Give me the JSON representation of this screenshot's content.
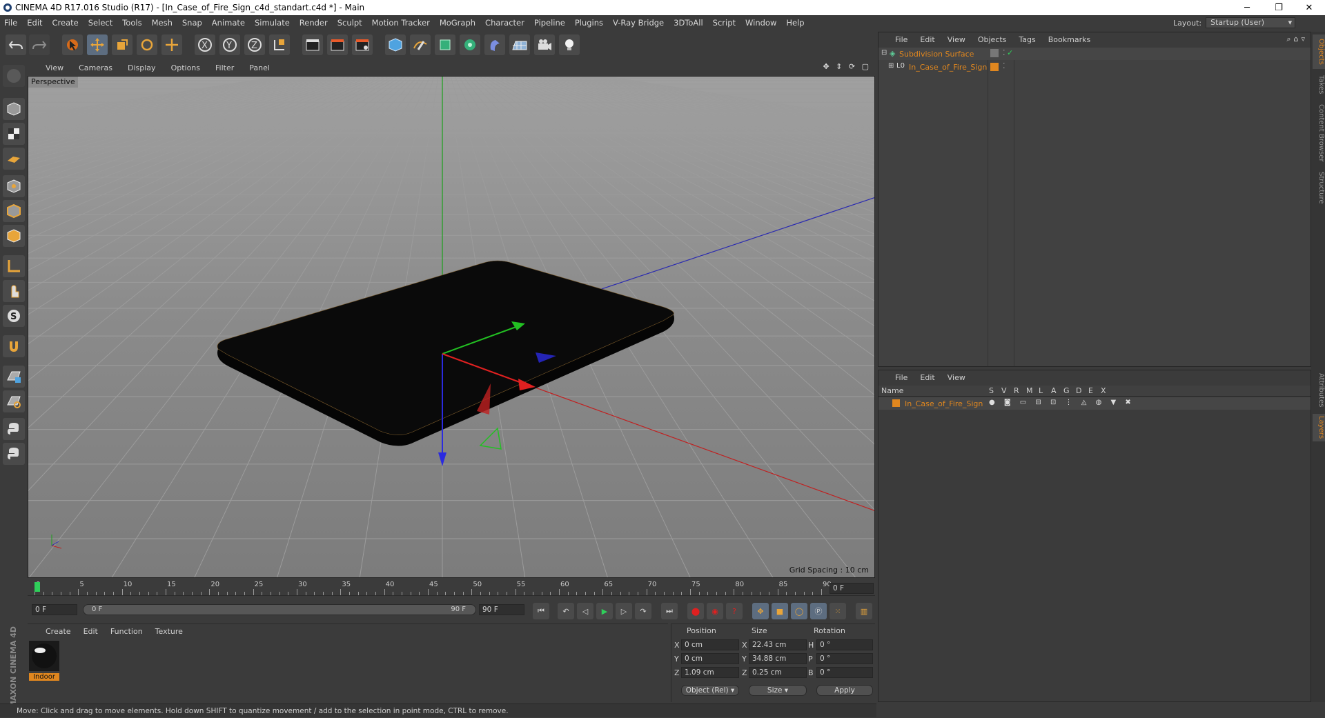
{
  "window": {
    "title": "CINEMA 4D R17.016 Studio (R17) - [In_Case_of_Fire_Sign_c4d_standart.c4d *] - Main",
    "minimize": "─",
    "restore": "❐",
    "close": "✕"
  },
  "menu": [
    "File",
    "Edit",
    "Create",
    "Select",
    "Tools",
    "Mesh",
    "Snap",
    "Animate",
    "Simulate",
    "Render",
    "Sculpt",
    "Motion Tracker",
    "MoGraph",
    "Character",
    "Pipeline",
    "Plugins",
    "V-Ray Bridge",
    "3DToAll",
    "Script",
    "Window",
    "Help"
  ],
  "layout": {
    "label": "Layout:",
    "value": "Startup (User)"
  },
  "viewport": {
    "menu": [
      "View",
      "Cameras",
      "Display",
      "Options",
      "Filter",
      "Panel"
    ],
    "name": "Perspective",
    "grid_spacing": "Grid Spacing : 10 cm"
  },
  "timeline": {
    "ticks": [
      "0",
      "5",
      "10",
      "15",
      "20",
      "25",
      "30",
      "35",
      "40",
      "45",
      "50",
      "55",
      "60",
      "65",
      "70",
      "75",
      "80",
      "85",
      "90"
    ],
    "current": "0 F",
    "start": "0 F",
    "range_start": "0 F",
    "range_end": "90 F",
    "end": "90 F"
  },
  "objects": {
    "menu": [
      "File",
      "Edit",
      "View",
      "Objects",
      "Tags",
      "Bookmarks"
    ],
    "items": [
      {
        "name": "Subdivision Surface"
      },
      {
        "name": "In_Case_of_Fire_Sign"
      }
    ]
  },
  "layers": {
    "menu": [
      "File",
      "Edit",
      "View"
    ],
    "columns": [
      "Name",
      "S",
      "V",
      "R",
      "M",
      "L",
      "A",
      "G",
      "D",
      "E",
      "X"
    ],
    "items": [
      {
        "name": "In_Case_of_Fire_Sign"
      }
    ]
  },
  "material": {
    "menu": [
      "Create",
      "Edit",
      "Function",
      "Texture"
    ],
    "items": [
      {
        "name": "Indoor"
      }
    ]
  },
  "coords": {
    "headers": [
      "Position",
      "Size",
      "Rotation"
    ],
    "rows": [
      {
        "axis": "X",
        "pos": "0 cm",
        "saxis": "X",
        "size": "22.43 cm",
        "raxis": "H",
        "rot": "0 °"
      },
      {
        "axis": "Y",
        "pos": "0 cm",
        "saxis": "Y",
        "size": "34.88 cm",
        "raxis": "P",
        "rot": "0 °"
      },
      {
        "axis": "Z",
        "pos": "1.09 cm",
        "saxis": "Z",
        "size": "0.25 cm",
        "raxis": "B",
        "rot": "0 °"
      }
    ],
    "mode": "Object (Rel)",
    "size_mode": "Size",
    "apply": "Apply"
  },
  "right_tabs": [
    "Objects",
    "Takes",
    "Content Browser",
    "Structure",
    "Attributes",
    "Layers"
  ],
  "brand": "MAXON CINEMA 4D",
  "status": "Move: Click and drag to move elements. Hold down SHIFT to quantize movement / add to the selection in point mode, CTRL to remove.",
  "colors": {
    "accent": "#e07a1f",
    "selection_blue": "#5d6d80",
    "object_orange": "#e0871f",
    "subdiv_green": "#5fd09a"
  }
}
